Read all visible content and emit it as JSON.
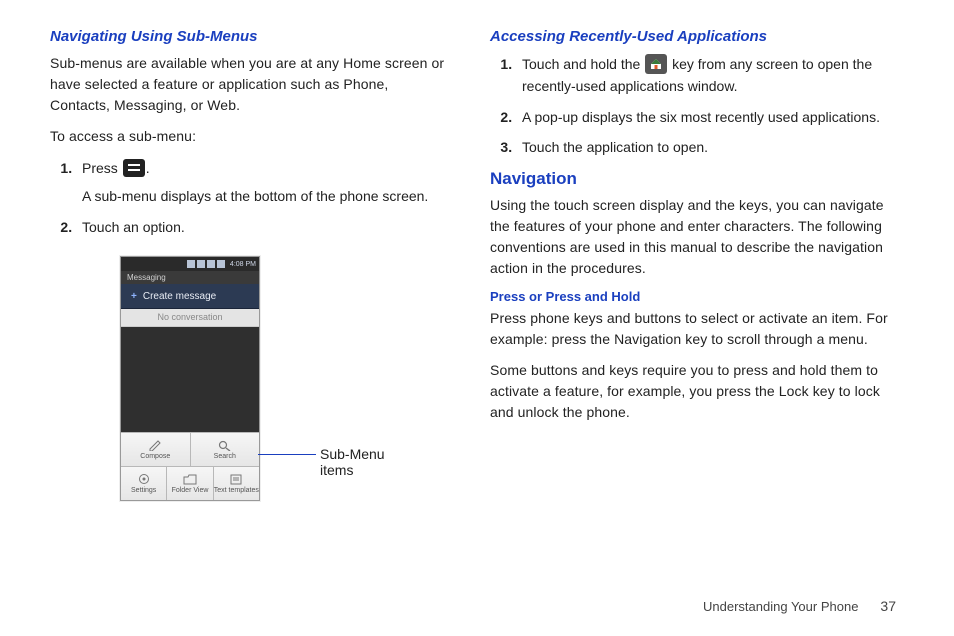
{
  "left": {
    "heading": "Navigating Using Sub-Menus",
    "intro": "Sub-menus are available when you are at any Home screen or have selected a feature or application such as Phone, Contacts, Messaging, or Web.",
    "lead": "To access a sub-menu:",
    "step1a": "Press ",
    "step1b": ".",
    "step1_sub": "A sub-menu displays at the bottom of the phone screen.",
    "step2": "Touch an option.",
    "phone": {
      "time": "4:08 PM",
      "titlebar": "Messaging",
      "create": "Create message",
      "noconv": "No conversation",
      "cells": [
        "Compose",
        "Search",
        "Settings",
        "Folder View",
        "Text templates"
      ]
    },
    "label": "Sub-Menu items"
  },
  "right": {
    "heading": "Accessing Recently-Used Applications",
    "step1a": "Touch and hold the ",
    "step1b": " key from any screen to open the recently-used applications window.",
    "step2": "A pop-up displays the six most recently used applications.",
    "step3": "Touch the application to open.",
    "nav_heading": "Navigation",
    "nav_body": "Using the touch screen display and the keys, you can navigate the features of your phone and enter characters. The following conventions are used in this manual to describe the navigation action in the procedures.",
    "press_heading": "Press or Press and Hold",
    "press_p1": "Press phone keys and buttons to select or activate an item. For example: press the Navigation key to scroll through a menu.",
    "press_p2": "Some buttons and keys require you to press and hold them to activate a feature, for example, you press the Lock key to lock and unlock the phone."
  },
  "footer": {
    "section": "Understanding Your Phone",
    "page": "37"
  }
}
